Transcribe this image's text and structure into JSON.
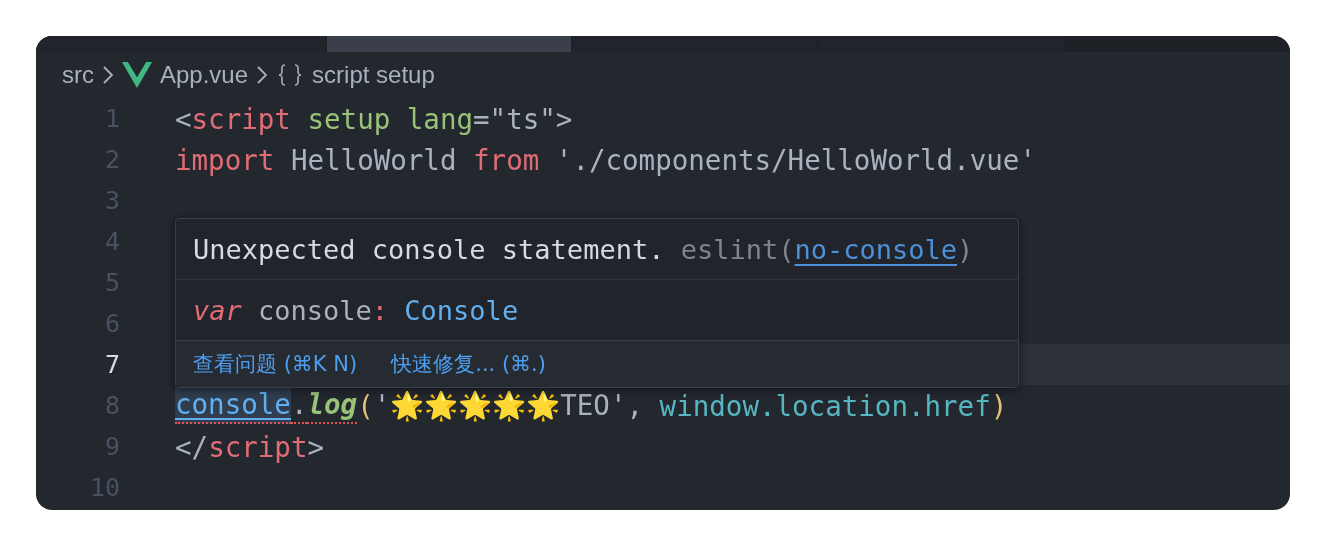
{
  "tabs": [
    {
      "selected": false
    },
    {
      "selected": true
    },
    {
      "selected": false
    },
    {
      "selected": false
    }
  ],
  "breadcrumb": [
    {
      "kind": "folder",
      "label": "src"
    },
    {
      "kind": "vue-file",
      "label": "App.vue"
    },
    {
      "kind": "symbol",
      "label": "script setup"
    }
  ],
  "lines": [
    {
      "number": "1",
      "current": false,
      "tokens": [
        {
          "text": "<",
          "kind": "punct"
        },
        {
          "text": "script",
          "kind": "tag"
        },
        {
          "text": " setup",
          "kind": "attr"
        },
        {
          "text": " lang",
          "kind": "attr"
        },
        {
          "text": "=\"ts\">",
          "kind": "plain"
        }
      ]
    },
    {
      "number": "2",
      "current": false,
      "tokens": [
        {
          "text": "import",
          "kind": "keyword"
        },
        {
          "text": " HelloWorld ",
          "kind": "plain"
        },
        {
          "text": "from",
          "kind": "keyword"
        },
        {
          "text": " './components/HelloWorld.vue'",
          "kind": "plain"
        }
      ]
    },
    {
      "number": "3",
      "current": false
    },
    {
      "number": "4",
      "current": false
    },
    {
      "number": "5",
      "current": false
    },
    {
      "number": "6",
      "current": false
    },
    {
      "number": "7",
      "current": true
    },
    {
      "number": "8",
      "current": false,
      "tokens": [
        {
          "text": "console",
          "kind": "hovered",
          "error": true
        },
        {
          "text": ".",
          "kind": "plain",
          "error": true
        },
        {
          "text": "log",
          "kind": "method",
          "error": true
        },
        {
          "text": "(",
          "kind": "paren"
        },
        {
          "text": "'🌟🌟🌟🌟🌟TEO',",
          "kind": "plain"
        },
        {
          "text": " window.location.href",
          "kind": "prop"
        },
        {
          "text": ")",
          "kind": "paren"
        }
      ]
    },
    {
      "number": "9",
      "current": false,
      "tokens": [
        {
          "text": "</",
          "kind": "punct"
        },
        {
          "text": "script",
          "kind": "tag"
        },
        {
          "text": ">",
          "kind": "punct"
        }
      ]
    },
    {
      "number": "10",
      "current": false
    }
  ],
  "hover": {
    "message": "Unexpected console statement.",
    "source": "eslint(",
    "rule": "no-console",
    "source_end": ")",
    "signature": [
      {
        "text": "var",
        "kind": "storage"
      },
      {
        "text": " console",
        "kind": "plain"
      },
      {
        "text": ": ",
        "kind": "tag"
      },
      {
        "text": "Console",
        "kind": "type"
      }
    ],
    "actions": [
      "查看问题 (⌘K N)",
      "快速修复... (⌘.)"
    ]
  }
}
